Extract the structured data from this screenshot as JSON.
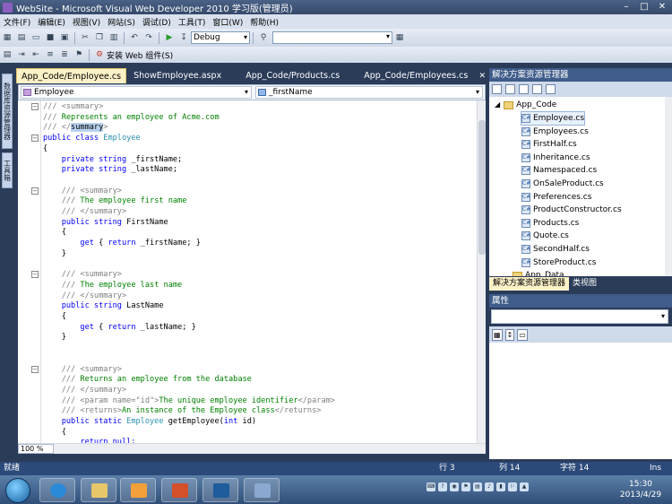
{
  "window": {
    "title": "WebSite - Microsoft Visual Web Developer 2010 学习版(管理员)"
  },
  "menu": [
    "文件(F)",
    "编辑(E)",
    "视图(V)",
    "网站(S)",
    "调试(D)",
    "工具(T)",
    "窗口(W)",
    "帮助(H)"
  ],
  "toolbar": {
    "config": "Debug",
    "install_label": "安装 Web 组件(S)"
  },
  "left_tabs": {
    "server": "数据库资源管理器",
    "toolbox": "工具箱"
  },
  "doc_tabs": [
    "App_Code/Employee.cs",
    "ShowEmployee.aspx",
    "App_Code/Products.cs",
    "App_Code/Employees.cs"
  ],
  "nav": {
    "class": "Employee",
    "member": "_firstName"
  },
  "code_lines": [
    [
      {
        "c": "cx",
        "t": "/// <summary>"
      }
    ],
    [
      {
        "c": "cx",
        "t": "/// "
      },
      {
        "c": "cm",
        "t": "Represents an employee of Acme.com"
      }
    ],
    [
      {
        "c": "cx",
        "t": "/// </"
      },
      {
        "c": "hl",
        "t": "summary"
      },
      {
        "c": "cx",
        "t": ">"
      }
    ],
    [
      {
        "c": "kw",
        "t": "public class "
      },
      {
        "c": "ty",
        "t": "Employee"
      }
    ],
    [
      {
        "c": "pl",
        "t": "{"
      }
    ],
    [
      {
        "c": "kw",
        "t": "    private string "
      },
      {
        "c": "pl",
        "t": "_firstName;"
      }
    ],
    [
      {
        "c": "kw",
        "t": "    private string "
      },
      {
        "c": "pl",
        "t": "_lastName;"
      }
    ],
    [],
    [
      {
        "c": "cx",
        "t": "    /// <summary>"
      }
    ],
    [
      {
        "c": "cx",
        "t": "    /// "
      },
      {
        "c": "cm",
        "t": "The employee first name"
      }
    ],
    [
      {
        "c": "cx",
        "t": "    /// </summary>"
      }
    ],
    [
      {
        "c": "kw",
        "t": "    public string "
      },
      {
        "c": "pl",
        "t": "FirstName"
      }
    ],
    [
      {
        "c": "pl",
        "t": "    {"
      }
    ],
    [
      {
        "c": "kw",
        "t": "        get "
      },
      {
        "c": "pl",
        "t": "{ "
      },
      {
        "c": "kw",
        "t": "return "
      },
      {
        "c": "pl",
        "t": "_firstName; }"
      }
    ],
    [
      {
        "c": "pl",
        "t": "    }"
      }
    ],
    [],
    [
      {
        "c": "cx",
        "t": "    /// <summary>"
      }
    ],
    [
      {
        "c": "cx",
        "t": "    /// "
      },
      {
        "c": "cm",
        "t": "The employee last name"
      }
    ],
    [
      {
        "c": "cx",
        "t": "    /// </summary>"
      }
    ],
    [
      {
        "c": "kw",
        "t": "    public string "
      },
      {
        "c": "pl",
        "t": "LastName"
      }
    ],
    [
      {
        "c": "pl",
        "t": "    {"
      }
    ],
    [
      {
        "c": "kw",
        "t": "        get "
      },
      {
        "c": "pl",
        "t": "{ "
      },
      {
        "c": "kw",
        "t": "return "
      },
      {
        "c": "pl",
        "t": "_lastName; }"
      }
    ],
    [
      {
        "c": "pl",
        "t": "    }"
      }
    ],
    [],
    [],
    [
      {
        "c": "cx",
        "t": "    /// <summary>"
      }
    ],
    [
      {
        "c": "cx",
        "t": "    /// "
      },
      {
        "c": "cm",
        "t": "Returns an employee from the database"
      }
    ],
    [
      {
        "c": "cx",
        "t": "    /// </summary>"
      }
    ],
    [
      {
        "c": "cx",
        "t": "    /// <param name=\"id\">"
      },
      {
        "c": "cm",
        "t": "The unique employee identifier"
      },
      {
        "c": "cx",
        "t": "</param>"
      }
    ],
    [
      {
        "c": "cx",
        "t": "    /// <returns>"
      },
      {
        "c": "cm",
        "t": "An instance of the Employee class"
      },
      {
        "c": "cx",
        "t": "</returns>"
      }
    ],
    [
      {
        "c": "kw",
        "t": "    public static "
      },
      {
        "c": "ty",
        "t": "Employee "
      },
      {
        "c": "pl",
        "t": "getEmployee("
      },
      {
        "c": "kw",
        "t": "int "
      },
      {
        "c": "pl",
        "t": "id)"
      }
    ],
    [
      {
        "c": "pl",
        "t": "    {"
      }
    ],
    [
      {
        "c": "kw",
        "t": "        return null;"
      }
    ]
  ],
  "zoom": "100 %",
  "solution_explorer": {
    "title": "解决方案资源管理器",
    "folder": "App_Code",
    "files": [
      "Employee.cs",
      "Employees.cs",
      "FirstHalf.cs",
      "Inheritance.cs",
      "Namespaced.cs",
      "OnSaleProduct.cs",
      "Preferences.cs",
      "ProductConstructor.cs",
      "Products.cs",
      "Quote.cs",
      "SecondHalf.cs",
      "StoreProduct.cs"
    ],
    "next_folder": "App_Data"
  },
  "panel_tabs": [
    "解决方案资源管理器",
    "类视图"
  ],
  "properties": {
    "title": "属性"
  },
  "status": {
    "ready": "就绪",
    "line": "行 3",
    "col": "列 14",
    "ch": "字符 14",
    "mode": "Ins"
  },
  "clock": {
    "time": "15:30",
    "date": "2013/4/29"
  }
}
